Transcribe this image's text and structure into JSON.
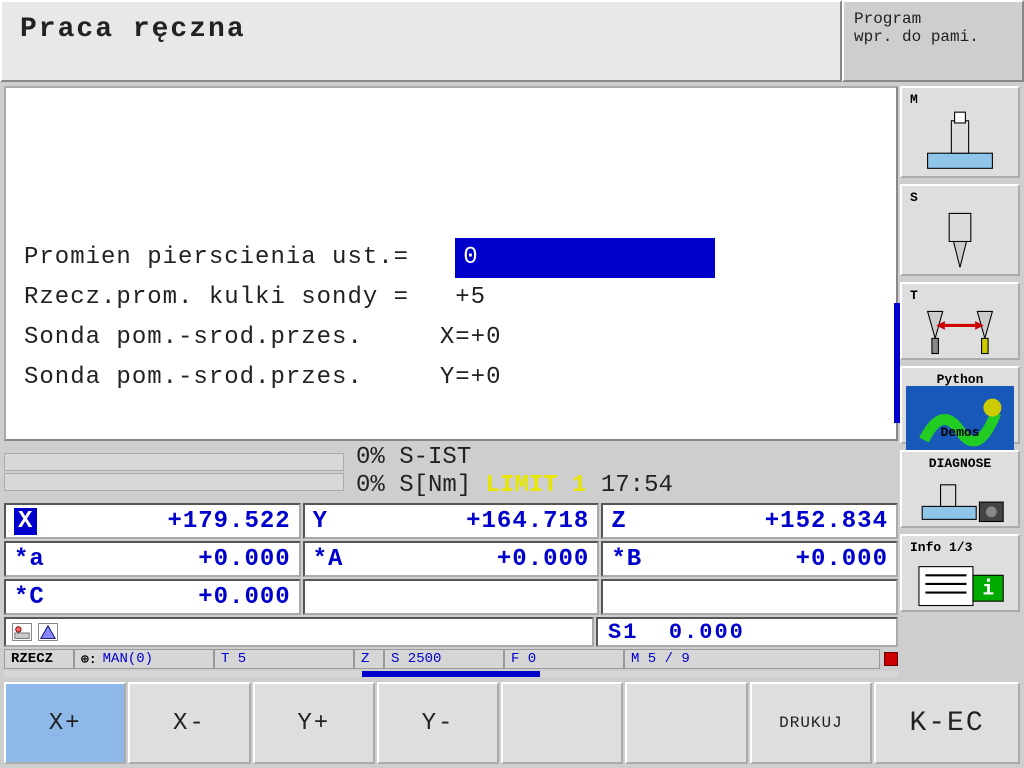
{
  "title": "Praca ręczna",
  "mode": {
    "line1": "Program",
    "line2": "wpr. do pami."
  },
  "params": [
    {
      "label": "Promien pierscienia ust.=",
      "value": "0",
      "highlight": true
    },
    {
      "label": "Rzecz.prom. kulki sondy =",
      "value": "+5",
      "highlight": false
    },
    {
      "label": "Sonda pom.-srod.przes.",
      "value": "X=+0",
      "highlight": false
    },
    {
      "label": "Sonda pom.-srod.przes.",
      "value": "Y=+0",
      "highlight": false
    }
  ],
  "status": {
    "s_ist_pct": "0%",
    "s_ist_label": "S-IST",
    "snm_pct": "0%",
    "snm_label": "S[Nm]",
    "limit": "LIMIT 1",
    "time": "17:54"
  },
  "coords": {
    "x": {
      "axis": "X",
      "val": "+179.522",
      "hl": true
    },
    "y": {
      "axis": "Y",
      "val": "+164.718"
    },
    "z": {
      "axis": "Z",
      "val": "+152.834"
    },
    "a": {
      "axis": "*a",
      "val": "+0.000"
    },
    "A": {
      "axis": "*A",
      "val": "+0.000"
    },
    "B": {
      "axis": "*B",
      "val": "+0.000"
    },
    "C": {
      "axis": "*C",
      "val": "+0.000"
    }
  },
  "spindle": {
    "label": "S1",
    "val": "0.000"
  },
  "info": {
    "mode": "RZECZ",
    "datum_label": "⊕:",
    "datum": "MAN(0)",
    "t": "T 5",
    "z": "Z",
    "s": "S 2500",
    "f": "F 0",
    "m": "M 5 / 9"
  },
  "sidebtns": {
    "m": "M",
    "s": "S",
    "t": "T",
    "python1": "Python",
    "python2": "Demos",
    "diag": "DIAGNOSE",
    "info": "Info 1/3"
  },
  "softkeys": {
    "xp": "X+",
    "xm": "X-",
    "yp": "Y+",
    "ym": "Y-",
    "print": "DRUKUJ",
    "kec": "K-EC"
  }
}
